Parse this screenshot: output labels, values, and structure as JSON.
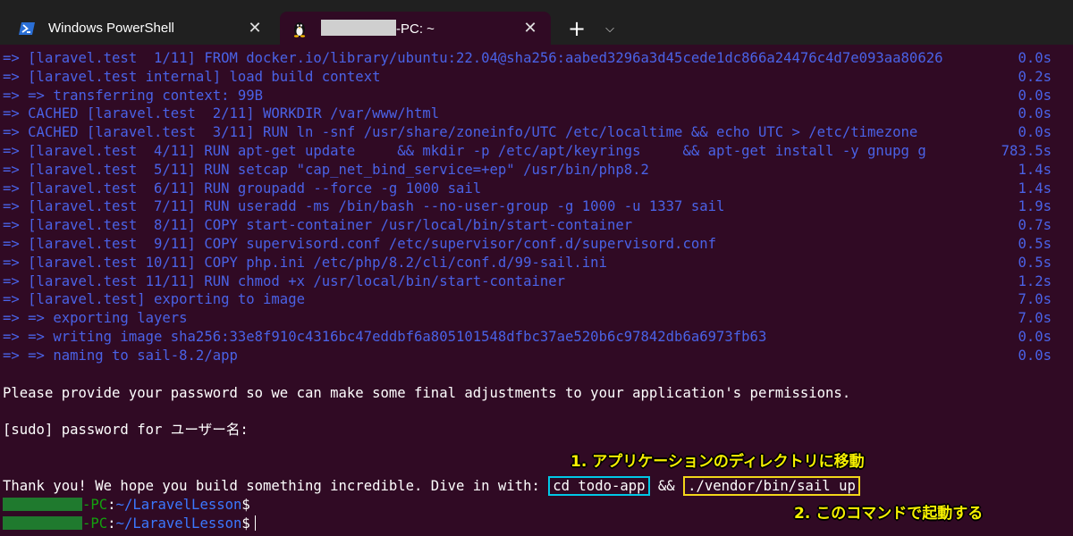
{
  "tabs": [
    {
      "title": "Windows PowerShell",
      "icon": "powershell-icon"
    },
    {
      "title": "-PC: ~",
      "icon": "linux-tux-icon"
    }
  ],
  "tab_controls": {
    "new_tab": "+",
    "dropdown": "⌵",
    "close": "✕"
  },
  "build_lines": [
    {
      "text": "=> [laravel.test  1/11] FROM docker.io/library/ubuntu:22.04@sha256:aabed3296a3d45cede1dc866a24476c4d7e093aa80626",
      "time": "0.0s"
    },
    {
      "text": "=> [laravel.test internal] load build context",
      "time": "0.2s"
    },
    {
      "text": "=> => transferring context: 99B",
      "time": "0.0s"
    },
    {
      "text": "=> CACHED [laravel.test  2/11] WORKDIR /var/www/html",
      "time": "0.0s"
    },
    {
      "text": "=> CACHED [laravel.test  3/11] RUN ln -snf /usr/share/zoneinfo/UTC /etc/localtime && echo UTC > /etc/timezone",
      "time": "0.0s"
    },
    {
      "text": "=> [laravel.test  4/11] RUN apt-get update     && mkdir -p /etc/apt/keyrings     && apt-get install -y gnupg g",
      "time": "783.5s"
    },
    {
      "text": "=> [laravel.test  5/11] RUN setcap \"cap_net_bind_service=+ep\" /usr/bin/php8.2",
      "time": "1.4s"
    },
    {
      "text": "=> [laravel.test  6/11] RUN groupadd --force -g 1000 sail",
      "time": "1.4s"
    },
    {
      "text": "=> [laravel.test  7/11] RUN useradd -ms /bin/bash --no-user-group -g 1000 -u 1337 sail",
      "time": "1.9s"
    },
    {
      "text": "=> [laravel.test  8/11] COPY start-container /usr/local/bin/start-container",
      "time": "0.7s"
    },
    {
      "text": "=> [laravel.test  9/11] COPY supervisord.conf /etc/supervisor/conf.d/supervisord.conf",
      "time": "0.5s"
    },
    {
      "text": "=> [laravel.test 10/11] COPY php.ini /etc/php/8.2/cli/conf.d/99-sail.ini",
      "time": "0.5s"
    },
    {
      "text": "=> [laravel.test 11/11] RUN chmod +x /usr/local/bin/start-container",
      "time": "1.2s"
    },
    {
      "text": "=> [laravel.test] exporting to image",
      "time": "7.0s"
    },
    {
      "text": "=> => exporting layers",
      "time": "7.0s"
    },
    {
      "text": "=> => writing image sha256:33e8f910c4316bc47eddbf6a805101548dfbc37ae520b6c97842db6a6973fb63",
      "time": "0.0s"
    },
    {
      "text": "=> => naming to sail-8.2/app",
      "time": "0.0s"
    }
  ],
  "message_lines": {
    "password_prompt": "Please provide your password so we can make some final adjustments to your application's permissions.",
    "sudo": "[sudo] password for ユーザー名:",
    "thanks": "Thank you! We hope you build something incredible. Dive in with: ",
    "cmd1": "cd todo-app",
    "and": " && ",
    "cmd2": "./vendor/bin/sail up"
  },
  "prompt": {
    "host_suffix": "-PC",
    "colon": ":",
    "path": "~/LaravelLesson",
    "symbol": "$"
  },
  "annotations": {
    "note1": "1. アプリケーションのディレクトリに移動",
    "note2": "2. このコマンドで起動する"
  },
  "colors": {
    "background": "#300a24",
    "build_text": "#4a62e6",
    "annotation_text": "#f6f000",
    "box1": "#00c8e6",
    "box2": "#f3d61a"
  }
}
